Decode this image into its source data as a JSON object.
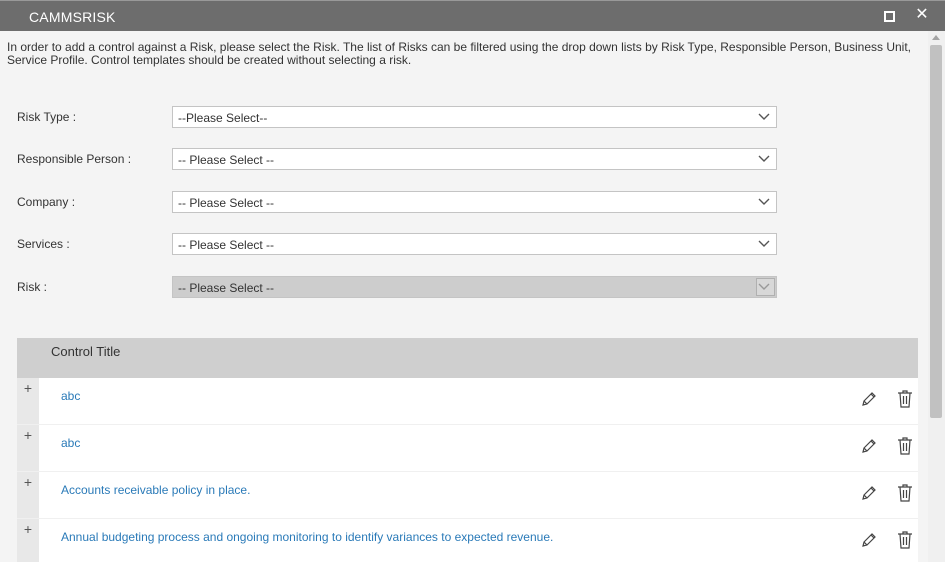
{
  "window": {
    "title": "CAMMSRISK",
    "maximize_icon": "maximize-icon",
    "close_icon": "close-icon",
    "close_glyph": "✕"
  },
  "intro_text": "In order to add a control against a Risk, please select the Risk. The list of Risks can be filtered using the drop down lists by Risk Type, Responsible Person, Business Unit, Service Profile. Control templates should be created without selecting a risk.",
  "filters": [
    {
      "label": "Risk Type :",
      "value": "--Please Select--",
      "disabled": false
    },
    {
      "label": "Responsible Person :",
      "value": "-- Please Select --",
      "disabled": false
    },
    {
      "label": "Company :",
      "value": "-- Please Select --",
      "disabled": false
    },
    {
      "label": "Services :",
      "value": "-- Please Select --",
      "disabled": false
    },
    {
      "label": "Risk :",
      "value": "-- Please Select --",
      "disabled": true
    }
  ],
  "grid": {
    "header": "Control Title",
    "rows": [
      {
        "expander": "+",
        "title": "abc"
      },
      {
        "expander": "+",
        "title": "abc"
      },
      {
        "expander": "+",
        "title": "Accounts receivable policy in place."
      },
      {
        "expander": "+",
        "title": "Annual budgeting process and ongoing monitoring to identify variances to expected revenue."
      }
    ],
    "row_icons": [
      "pencil-icon",
      "trash-icon"
    ]
  },
  "colors": {
    "titlebar": "#6d6d6d",
    "link": "#2a7ab8",
    "grid_header": "#cfcfcf",
    "background": "#f4f4f4"
  }
}
